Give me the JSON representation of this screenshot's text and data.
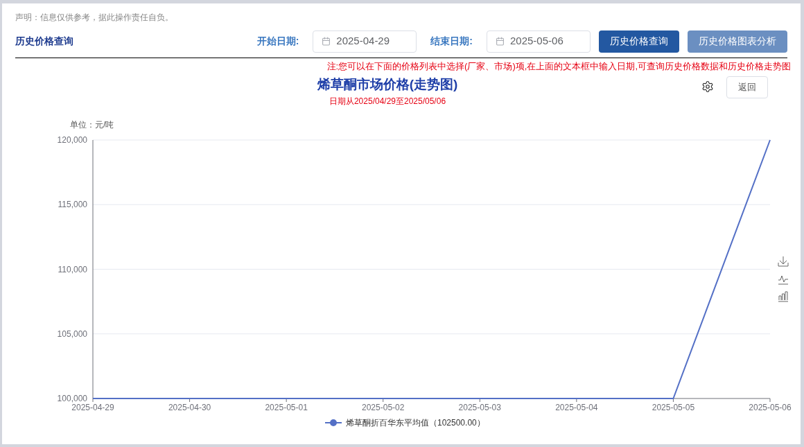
{
  "disclaimer": "声明：信息仅供参考，据此操作责任自负。",
  "toolbar": {
    "title": "历史价格查询",
    "start_label": "开始日期:",
    "start_value": "2025-04-29",
    "end_label": "结束日期:",
    "end_value": "2025-05-06",
    "buttons": [
      {
        "label": "历史价格查询",
        "kind": "primary"
      },
      {
        "label": "历史价格图表分析",
        "kind": "secondary"
      }
    ]
  },
  "notice": "注:您可以在下面的价格列表中选择(厂家、市场)项,在上面的文本框中输入日期,可查询历史价格数据和历史价格走势图",
  "chart_header": {
    "title": "烯草酮市场价格(走势图)",
    "subtitle": "日期从2025/04/29至2025/05/06",
    "back_button": "返回"
  },
  "chart_data": {
    "type": "line",
    "ylabel": "单位：元/吨",
    "categories": [
      "2025-04-29",
      "2025-04-30",
      "2025-05-01",
      "2025-05-02",
      "2025-05-03",
      "2025-05-04",
      "2025-05-05",
      "2025-05-06"
    ],
    "series": [
      {
        "name": "烯草酮折百华东平均值（102500.00）",
        "color": "#5470c6",
        "values": [
          100000,
          100000,
          100000,
          100000,
          100000,
          100000,
          100000,
          120000
        ]
      }
    ],
    "ylim": [
      100000,
      120000
    ],
    "grid": true,
    "yticks": [
      {
        "value": 100000,
        "label": "100,000"
      },
      {
        "value": 105000,
        "label": "105,000"
      },
      {
        "value": 110000,
        "label": "110,000"
      },
      {
        "value": 115000,
        "label": "115,000"
      },
      {
        "value": 120000,
        "label": "120,000"
      }
    ]
  }
}
